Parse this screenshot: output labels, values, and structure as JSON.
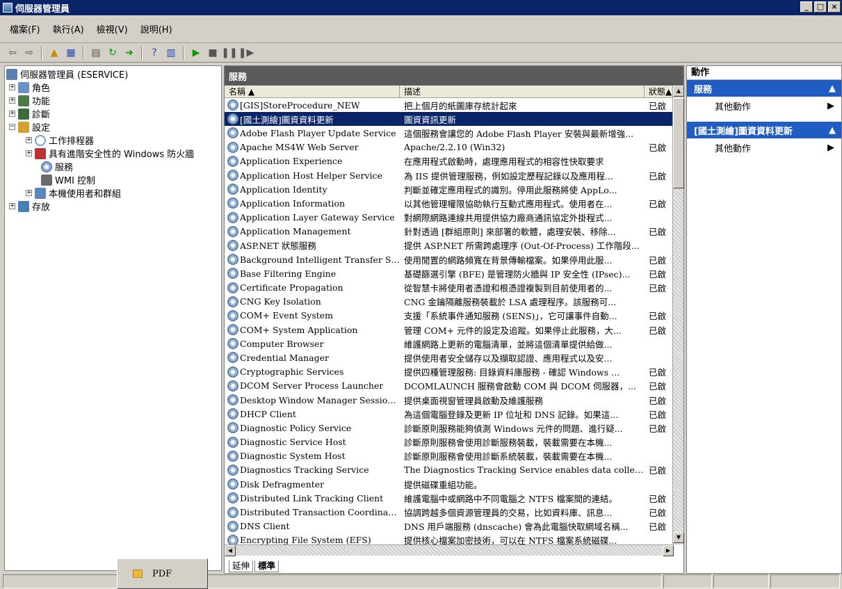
{
  "window": {
    "title": "伺服器管理員",
    "controls": [
      "_",
      "□",
      "×"
    ]
  },
  "menu": {
    "items": [
      "檔案(F)",
      "執行(A)",
      "檢視(V)",
      "說明(H)"
    ]
  },
  "tree": {
    "items": [
      {
        "label": "伺服器管理員 (ESERVICE)",
        "expander": "",
        "indent": 0,
        "icon": "server-icon"
      },
      {
        "label": "角色",
        "expander": "⊞",
        "indent": 0,
        "icon": "roles-icon"
      },
      {
        "label": "功能",
        "expander": "⊞",
        "indent": 0,
        "icon": "features-icon"
      },
      {
        "label": "診斷",
        "expander": "⊞",
        "indent": 0,
        "icon": "diagnostics-icon"
      },
      {
        "label": "設定",
        "expander": "⊟",
        "indent": 0,
        "icon": "configuration-icon"
      },
      {
        "label": "工作排程器",
        "expander": "⊞",
        "indent": 1,
        "icon": "clock-icon"
      },
      {
        "label": "具有進階安全性的 Windows 防火牆",
        "expander": "⊞",
        "indent": 1,
        "icon": "firewall-icon"
      },
      {
        "label": "服務",
        "expander": "",
        "indent": 1,
        "icon": "services-gear-icon"
      },
      {
        "label": "WMI 控制",
        "expander": "",
        "indent": 1,
        "icon": "wmi-icon"
      },
      {
        "label": "本機使用者和群組",
        "expander": "⊞",
        "indent": 1,
        "icon": "users-icon"
      },
      {
        "label": "存放",
        "expander": "⊞",
        "indent": 0,
        "icon": "storage-icon"
      }
    ]
  },
  "services": {
    "title": "服務",
    "columns": {
      "name": "名稱 ▲",
      "desc": "描述",
      "status": "狀態▲"
    },
    "rows": [
      {
        "name": "[GIS]StoreProcedure_NEW",
        "desc": "把上個月的紙圖庫存統計起來",
        "status": "已啟"
      },
      {
        "name": "[國土測繪]圖資資料更新",
        "desc": "圖資資訊更新",
        "status": "",
        "selected": true
      },
      {
        "name": "Adobe Flash Player Update Service",
        "desc": "這個服務會讓您的 Adobe Flash Player 安裝與最新增強...",
        "status": ""
      },
      {
        "name": "Apache MS4W Web Server",
        "desc": "Apache/2.2.10 (Win32)",
        "status": "已啟"
      },
      {
        "name": "Application Experience",
        "desc": "在應用程式啟動時，處理應用程式的相容性快取要求",
        "status": ""
      },
      {
        "name": "Application Host Helper Service",
        "desc": "為 IIS 提供管理服務，例如設定歷程記錄以及應用程...",
        "status": "已啟"
      },
      {
        "name": "Application Identity",
        "desc": "判斷並確定應用程式的識別。停用此服務將使 AppLo...",
        "status": ""
      },
      {
        "name": "Application Information",
        "desc": "以其他管理權限協助執行互動式應用程式。使用者在...",
        "status": "已啟"
      },
      {
        "name": "Application Layer Gateway Service",
        "desc": "對網際網路連線共用提供協力廠商通訊協定外掛程式...",
        "status": ""
      },
      {
        "name": "Application Management",
        "desc": "針對透過 [群組原則] 來部署的軟體，處理安裝、移除...",
        "status": "已啟"
      },
      {
        "name": "ASP.NET 狀態服務",
        "desc": "提供 ASP.NET 所需跨處理序 (Out-Of-Process) 工作階段...",
        "status": ""
      },
      {
        "name": "Background Intelligent Transfer Service",
        "desc": "使用閒置的網路頻寬在背景傳輸檔案。如果停用此服...",
        "status": "已啟"
      },
      {
        "name": "Base Filtering Engine",
        "desc": "基礎篩選引擎 (BFE) 是管理防火牆與 IP 安全性 (IPsec)...",
        "status": "已啟"
      },
      {
        "name": "Certificate Propagation",
        "desc": "從智慧卡將使用者憑證和根憑證複製到目前使用者的...",
        "status": "已啟"
      },
      {
        "name": "CNG Key Isolation",
        "desc": "CNG 金鑰隔離服務裝載於 LSA 處理程序。該服務可...",
        "status": ""
      },
      {
        "name": "COM+ Event System",
        "desc": "支援「系統事件通知服務 (SENS)」，它可讓事件自動...",
        "status": "已啟"
      },
      {
        "name": "COM+ System Application",
        "desc": "管理 COM+ 元件的設定及追蹤。如果停止此服務，大...",
        "status": "已啟"
      },
      {
        "name": "Computer Browser",
        "desc": "維護網路上更新的電腦清單，並將這個清單提供給做...",
        "status": ""
      },
      {
        "name": "Credential Manager",
        "desc": "提供使用者安全儲存以及擷取認證、應用程式以及安...",
        "status": ""
      },
      {
        "name": "Cryptographic Services",
        "desc": "提供四種管理服務: 目錄資料庫服務 - 確認 Windows ...",
        "status": "已啟"
      },
      {
        "name": "DCOM Server Process Launcher",
        "desc": "DCOMLAUNCH 服務會啟動 COM 與 DCOM 伺服器，...",
        "status": "已啟"
      },
      {
        "name": "Desktop Window Manager Session M...",
        "desc": "提供桌面視窗管理員啟動及維護服務",
        "status": "已啟"
      },
      {
        "name": "DHCP Client",
        "desc": "為這個電腦登錄及更新 IP 位址和 DNS 記錄。如果這...",
        "status": "已啟"
      },
      {
        "name": "Diagnostic Policy Service",
        "desc": "診斷原則服務能夠偵測 Windows 元件的問題、進行疑...",
        "status": "已啟"
      },
      {
        "name": "Diagnostic Service Host",
        "desc": "診斷原則服務會使用診斷服務裝載，裝載需要在本機...",
        "status": ""
      },
      {
        "name": "Diagnostic System Host",
        "desc": "診斷原則服務會使用診斷系統裝載，裝載需要在本機...",
        "status": ""
      },
      {
        "name": "Diagnostics Tracking Service",
        "desc": "The Diagnostics Tracking Service enables data collection ab...",
        "status": "已啟"
      },
      {
        "name": "Disk Defragmenter",
        "desc": "提供磁碟重組功能。",
        "status": ""
      },
      {
        "name": "Distributed Link Tracking Client",
        "desc": "維護電腦中或網路中不同電腦之 NTFS 檔案間的連結。",
        "status": "已啟"
      },
      {
        "name": "Distributed Transaction Coordinator",
        "desc": "協調跨越多個資源管理員的交易，比如資料庫、訊息...",
        "status": "已啟"
      },
      {
        "name": "DNS Client",
        "desc": "DNS 用戶端服務 (dnscache) 會為此電腦快取網域名稱...",
        "status": "已啟"
      },
      {
        "name": "Encrypting File System (EFS)",
        "desc": "提供核心檔案加密技術，可以在 NTFS 檔案系統磁碟...",
        "status": ""
      }
    ],
    "tabs": {
      "extended": "延伸",
      "standard": "標準"
    }
  },
  "actions": {
    "title": "動作",
    "section1": "服務",
    "section1_item": "其他動作",
    "section2": "[國土測繪]圖資資料更新",
    "section2_item": "其他動作"
  },
  "taskbar": {
    "pdf_label": "PDF"
  }
}
